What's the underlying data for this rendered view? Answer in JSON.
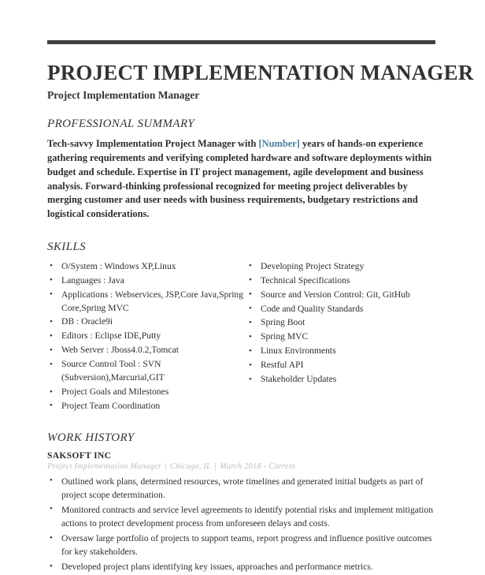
{
  "theme": {
    "rule_color": "#3e3e3e",
    "text_color": "#2d2d2d",
    "placeholder_color": "#4a7f98",
    "meta_color": "#bdbdbd",
    "background": "#ffffff"
  },
  "header": {
    "title": "PROJECT IMPLEMENTATION MANAGER",
    "subtitle": "Project Implementation Manager"
  },
  "summary": {
    "heading": "PROFESSIONAL SUMMARY",
    "text_before": "Tech-savvy Implementation Project Manager with ",
    "placeholder": "[Number]",
    "text_after": " years of hands-on experience gathering requirements and verifying completed hardware and software deployments within budget and schedule. Expertise in IT project management, agile development and business analysis. Forward-thinking professional recognized for meeting project deliverables by merging customer and user needs with business requirements, budgetary restrictions and logistical considerations."
  },
  "skills": {
    "heading": "SKILLS",
    "left_column": [
      "O/System : Windows XP,Linux",
      "Languages : Java",
      "Applications : Webservices, JSP,Core Java,Spring Core,Spring MVC",
      "DB : Oracle9i",
      "Editors : Eclipse IDE,Putty",
      "Web Server : Jboss4.0.2,Tomcat",
      "Source Control Tool : SVN (Subversion),Marcurial,GIT",
      "Project Goals and Milestones",
      "Project Team Coordination"
    ],
    "right_column": [
      "Developing Project Strategy",
      "Technical Specifications",
      "Source and Version Control: Git, GitHub",
      "Code and Quality Standards",
      "Spring Boot",
      "Spring MVC",
      "Linux Environments",
      "Restful API",
      "Stakeholder Updates"
    ]
  },
  "work_history": {
    "heading": "WORK HISTORY",
    "entries": [
      {
        "company": "SAKSOFT INC",
        "role": "Project Implementation Manager",
        "location": "Chicago, IL",
        "dates": "March 2018 - Current",
        "bullets": [
          "Outlined work plans, determined resources, wrote timelines and generated initial budgets as part of project scope determination.",
          "Monitored contracts and service level agreements to identify potential risks and implement mitigation actions to protect development process from unforeseen delays and costs.",
          "Oversaw large portfolio of projects to support teams, report progress and influence positive outcomes for key stakeholders.",
          "Developed project plans identifying key issues, approaches and performance metrics."
        ]
      }
    ]
  }
}
